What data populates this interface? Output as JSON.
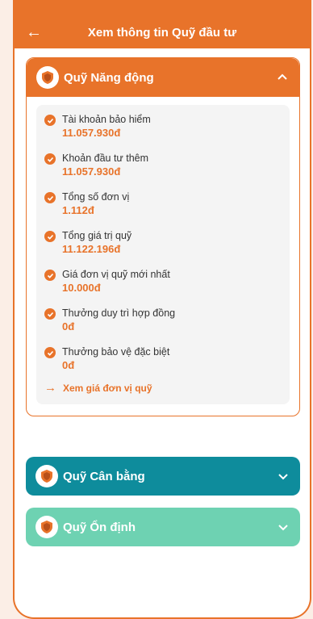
{
  "header": {
    "back_icon": "arrow-left-icon",
    "title": "Xem thông tin Quỹ đầu tư"
  },
  "colors": {
    "primary": "#e8732a",
    "teal": "#0e8c9c",
    "mint": "#6ed2b2"
  },
  "funds": [
    {
      "name": "Quỹ Năng động",
      "expanded": true,
      "details": [
        {
          "label": "Tài khoản bảo hiểm",
          "value": "11.057.930đ"
        },
        {
          "label": "Khoản đầu tư thêm",
          "value": "11.057.930đ"
        },
        {
          "label": "Tổng số đơn vị",
          "value": "1.112đ"
        },
        {
          "label": "Tổng giá trị quỹ",
          "value": "11.122.196đ"
        },
        {
          "label": "Giá đơn vị quỹ mới nhất",
          "value": "10.000đ"
        },
        {
          "label": "Thưởng duy trì hợp đồng",
          "value": "0đ"
        },
        {
          "label": "Thưởng bảo vệ đặc biệt",
          "value": "0đ"
        }
      ],
      "link_label": "Xem giá đơn vị quỹ"
    },
    {
      "name": "Quỹ Cân bằng",
      "expanded": false
    },
    {
      "name": "Quỹ Ổn định",
      "expanded": false
    }
  ]
}
